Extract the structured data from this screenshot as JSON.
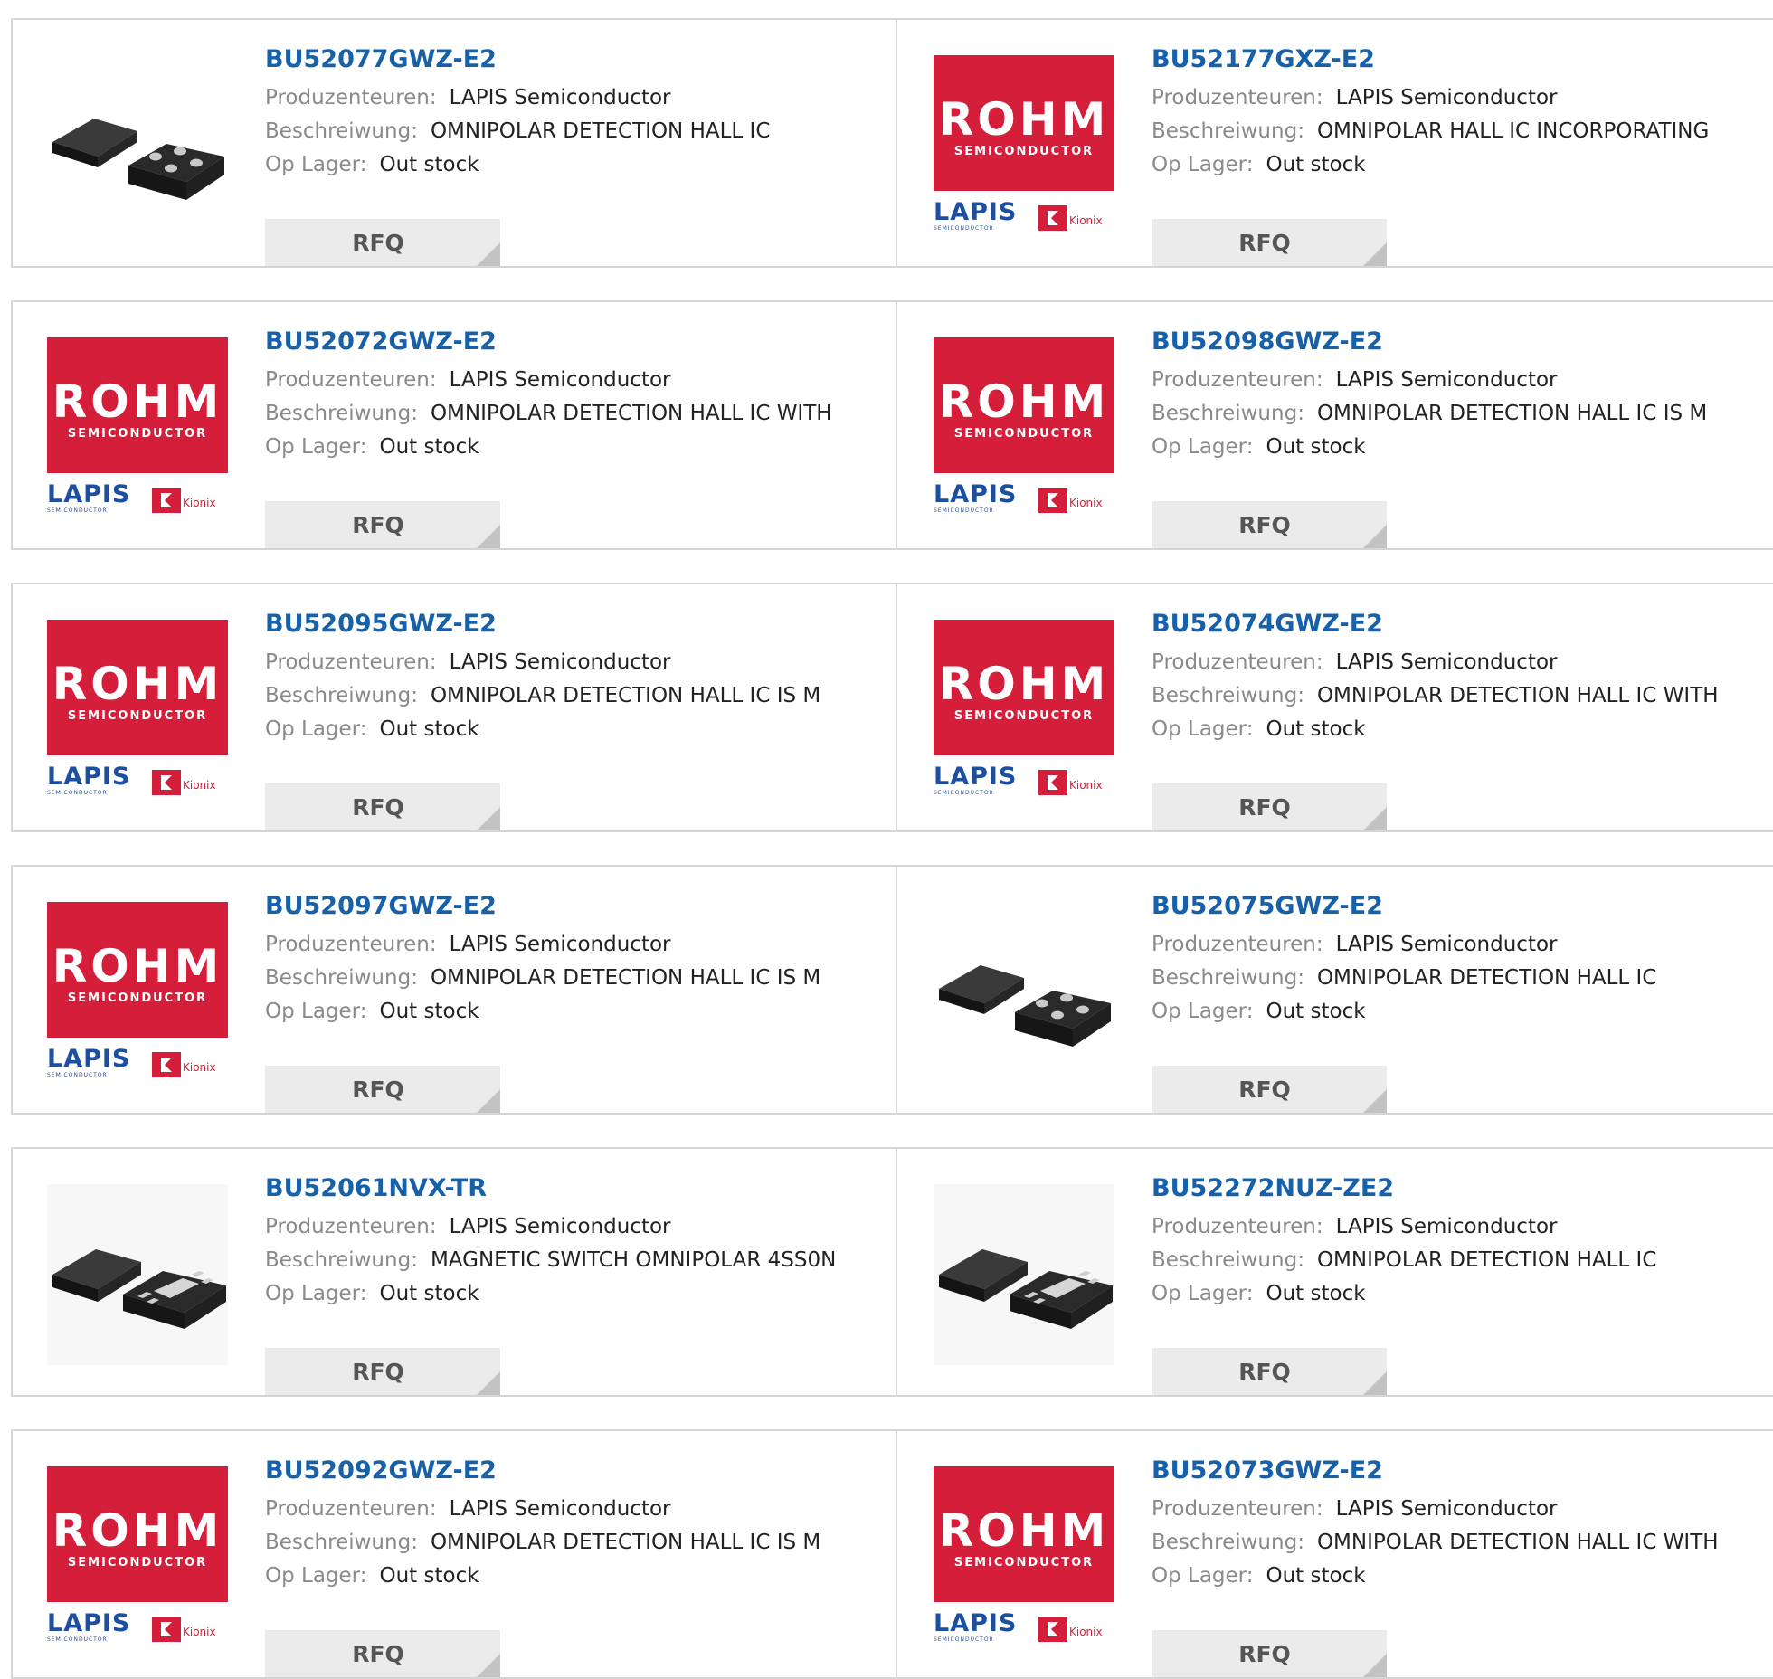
{
  "labels": {
    "manufacturer": "Produzenteuren:",
    "description": "Beschreiwung:",
    "stock": "Op Lager:",
    "rfq": "RFQ"
  },
  "logo": {
    "rohm": "ROHM",
    "rohm_sub": "SEMICONDUCTOR",
    "lapis": "LAPIS",
    "lapis_sub": "SEMICONDUCTOR",
    "kionix": "Kionix"
  },
  "colors": {
    "link": "#1661a9",
    "rohm_red": "#d41e3a",
    "button_bg": "#ebebeb"
  },
  "products": [
    {
      "part": "BU52077GWZ-E2",
      "manufacturer": "LAPIS Semiconductor",
      "description": "OMNIPOLAR DETECTION HALL IC",
      "stock": "Out stock",
      "image": "chip-4pad"
    },
    {
      "part": "BU52177GXZ-E2",
      "manufacturer": "LAPIS Semiconductor",
      "description": "OMNIPOLAR HALL IC INCORPORATING",
      "stock": "Out stock",
      "image": "rohm-logo"
    },
    {
      "part": "BU52072GWZ-E2",
      "manufacturer": "LAPIS Semiconductor",
      "description": "OMNIPOLAR DETECTION HALL IC WITH",
      "stock": "Out stock",
      "image": "rohm-logo"
    },
    {
      "part": "BU52098GWZ-E2",
      "manufacturer": "LAPIS Semiconductor",
      "description": "OMNIPOLAR DETECTION HALL IC IS M",
      "stock": "Out stock",
      "image": "rohm-logo"
    },
    {
      "part": "BU52095GWZ-E2",
      "manufacturer": "LAPIS Semiconductor",
      "description": "OMNIPOLAR DETECTION HALL IC IS M",
      "stock": "Out stock",
      "image": "rohm-logo"
    },
    {
      "part": "BU52074GWZ-E2",
      "manufacturer": "LAPIS Semiconductor",
      "description": "OMNIPOLAR DETECTION HALL IC WITH",
      "stock": "Out stock",
      "image": "rohm-logo"
    },
    {
      "part": "BU52097GWZ-E2",
      "manufacturer": "LAPIS Semiconductor",
      "description": "OMNIPOLAR DETECTION HALL IC IS M",
      "stock": "Out stock",
      "image": "rohm-logo"
    },
    {
      "part": "BU52075GWZ-E2",
      "manufacturer": "LAPIS Semiconductor",
      "description": "OMNIPOLAR DETECTION HALL IC",
      "stock": "Out stock",
      "image": "chip-4pad"
    },
    {
      "part": "BU52061NVX-TR",
      "manufacturer": "LAPIS Semiconductor",
      "description": "MAGNETIC SWITCH OMNIPOLAR 4SS0N",
      "stock": "Out stock",
      "image": "chip-son"
    },
    {
      "part": "BU52272NUZ-ZE2",
      "manufacturer": "LAPIS Semiconductor",
      "description": "OMNIPOLAR DETECTION HALL IC",
      "stock": "Out stock",
      "image": "chip-son"
    },
    {
      "part": "BU52092GWZ-E2",
      "manufacturer": "LAPIS Semiconductor",
      "description": "OMNIPOLAR DETECTION HALL IC IS M",
      "stock": "Out stock",
      "image": "rohm-logo"
    },
    {
      "part": "BU52073GWZ-E2",
      "manufacturer": "LAPIS Semiconductor",
      "description": "OMNIPOLAR DETECTION HALL IC WITH",
      "stock": "Out stock",
      "image": "rohm-logo"
    }
  ]
}
